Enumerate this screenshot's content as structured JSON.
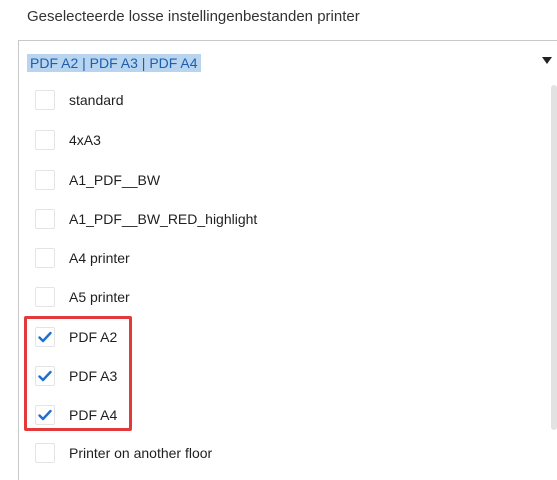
{
  "heading": "Geselecteerde losse instellingenbestanden printer",
  "dropdown": {
    "selected_value": "PDF A2 | PDF A3 | PDF A4",
    "caret_icon": "caret-down-icon"
  },
  "options": [
    {
      "label": "standard",
      "checked": false
    },
    {
      "label": "4xA3",
      "checked": false
    },
    {
      "label": "A1_PDF__BW",
      "checked": false
    },
    {
      "label": "A1_PDF__BW_RED_highlight",
      "checked": false
    },
    {
      "label": "A4 printer",
      "checked": false
    },
    {
      "label": "A5 printer",
      "checked": false
    },
    {
      "label": "PDF A2",
      "checked": true
    },
    {
      "label": "PDF A3",
      "checked": true
    },
    {
      "label": "PDF A4",
      "checked": true
    },
    {
      "label": "Printer on another floor",
      "checked": false
    }
  ],
  "colors": {
    "checkmark": "#1f6fd1",
    "selection_background": "#b9d4ee",
    "highlight_border": "#e2393b"
  }
}
